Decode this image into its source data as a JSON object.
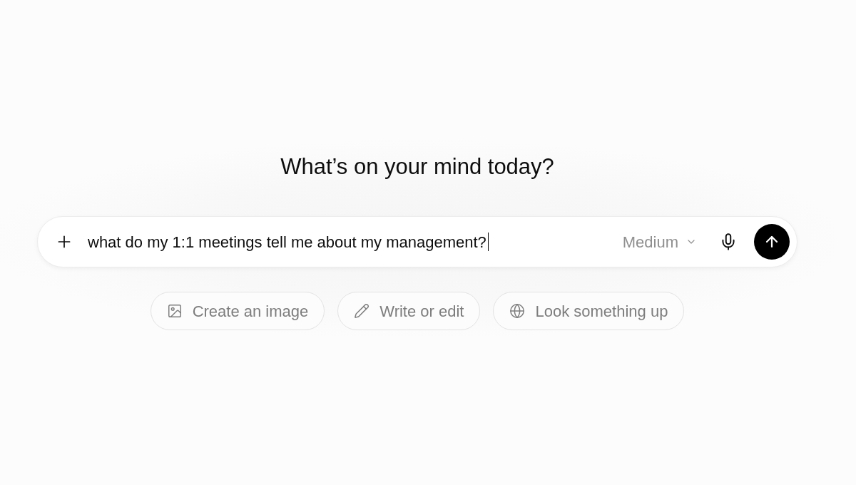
{
  "heading": "What’s on your mind today?",
  "composer": {
    "value": "what do my 1:1 meetings tell me about my management?",
    "model": "Medium"
  },
  "suggestions": [
    {
      "kind": "image",
      "label": "Create an image"
    },
    {
      "kind": "write",
      "label": "Write or edit"
    },
    {
      "kind": "search",
      "label": "Look something up"
    }
  ]
}
